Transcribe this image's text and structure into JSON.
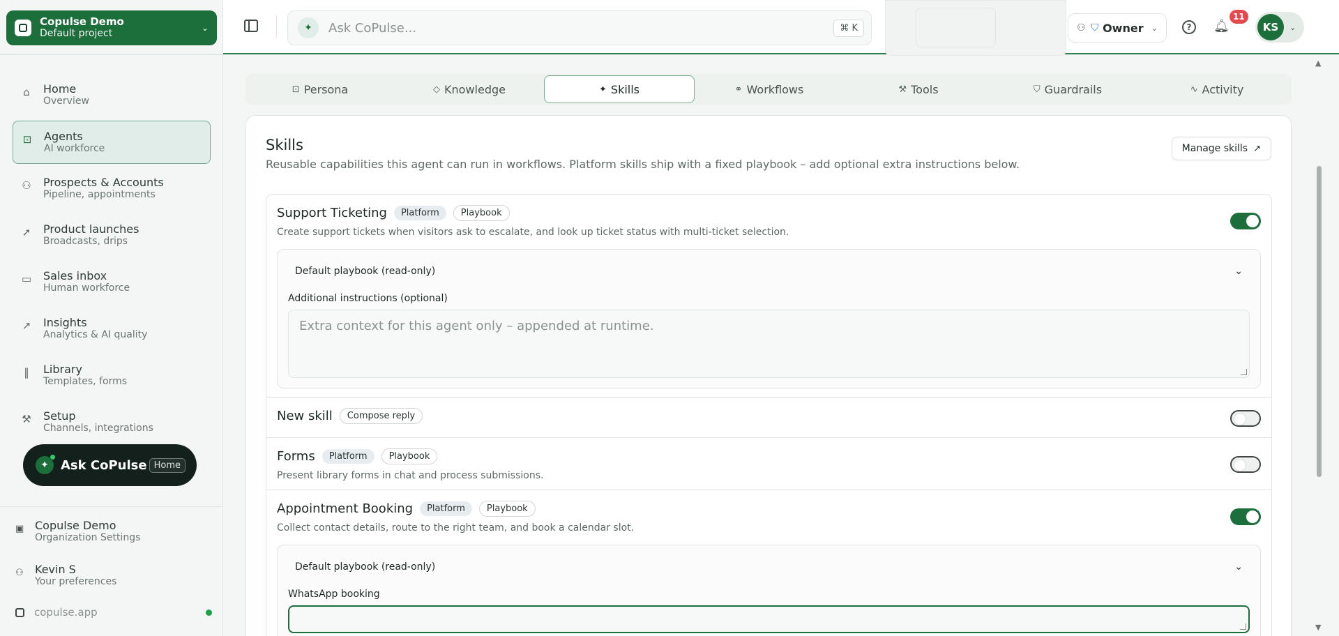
{
  "project": {
    "name": "Copulse Demo",
    "subtitle": "Default project"
  },
  "nav": [
    {
      "label": "Home",
      "sub": "Overview",
      "icon": "home-icon",
      "glyph": "⌂"
    },
    {
      "label": "Agents",
      "sub": "AI workforce",
      "icon": "robot-icon",
      "glyph": "⊡"
    },
    {
      "label": "Prospects & Accounts",
      "sub": "Pipeline, appointments",
      "icon": "users-icon",
      "glyph": "⚇"
    },
    {
      "label": "Product launches",
      "sub": "Broadcasts, drips",
      "icon": "rocket-icon",
      "glyph": "➚"
    },
    {
      "label": "Sales inbox",
      "sub": "Human workforce",
      "icon": "inbox-icon",
      "glyph": "▭"
    },
    {
      "label": "Insights",
      "sub": "Analytics & AI quality",
      "icon": "chart-icon",
      "glyph": "↗"
    },
    {
      "label": "Library",
      "sub": "Templates, forms",
      "icon": "library-icon",
      "glyph": "‖"
    },
    {
      "label": "Setup",
      "sub": "Channels, integrations",
      "icon": "wrench-icon",
      "glyph": "⚒"
    }
  ],
  "ask_pill": {
    "label": "Ask CoPulse",
    "badge": "Home"
  },
  "footer": {
    "org": {
      "label": "Copulse Demo",
      "sub": "Organization Settings"
    },
    "user": {
      "label": "Kevin S",
      "sub": "Your preferences"
    },
    "domain": "copulse.app"
  },
  "topbar": {
    "search_placeholder": "Ask CoPulse...",
    "shortcut": "⌘ K",
    "role": "Owner",
    "notifications": "11",
    "avatar": "KS"
  },
  "tabs": [
    {
      "label": "Persona",
      "glyph": "⊡"
    },
    {
      "label": "Knowledge",
      "glyph": "◇"
    },
    {
      "label": "Skills",
      "glyph": "✦"
    },
    {
      "label": "Workflows",
      "glyph": "⚭"
    },
    {
      "label": "Tools",
      "glyph": "⚒"
    },
    {
      "label": "Guardrails",
      "glyph": "⛉"
    },
    {
      "label": "Activity",
      "glyph": "∿"
    }
  ],
  "skills_section": {
    "title": "Skills",
    "description": "Reusable capabilities this agent can run in workflows. Platform skills ship with a fixed playbook – add optional extra instructions below.",
    "manage_label": "Manage skills"
  },
  "skills": [
    {
      "name": "Support Ticketing",
      "chip1": "Platform",
      "chip2": "Playbook",
      "desc": "Create support tickets when visitors ask to escalate, and look up ticket status with multi-ticket selection.",
      "enabled": true,
      "playbook_label": "Default playbook (read-only)",
      "field_label": "Additional instructions (optional)",
      "placeholder": "Extra context for this agent only – appended at runtime."
    },
    {
      "name": "New skill",
      "chip1": "Compose reply",
      "enabled": false
    },
    {
      "name": "Forms",
      "chip1": "Platform",
      "chip2": "Playbook",
      "desc": "Present library forms in chat and process submissions.",
      "enabled": false
    },
    {
      "name": "Appointment Booking",
      "chip1": "Platform",
      "chip2": "Playbook",
      "desc": "Collect contact details, route to the right team, and book a calendar slot.",
      "enabled": true,
      "playbook_label": "Default playbook (read-only)",
      "field_label": "WhatsApp booking"
    }
  ]
}
